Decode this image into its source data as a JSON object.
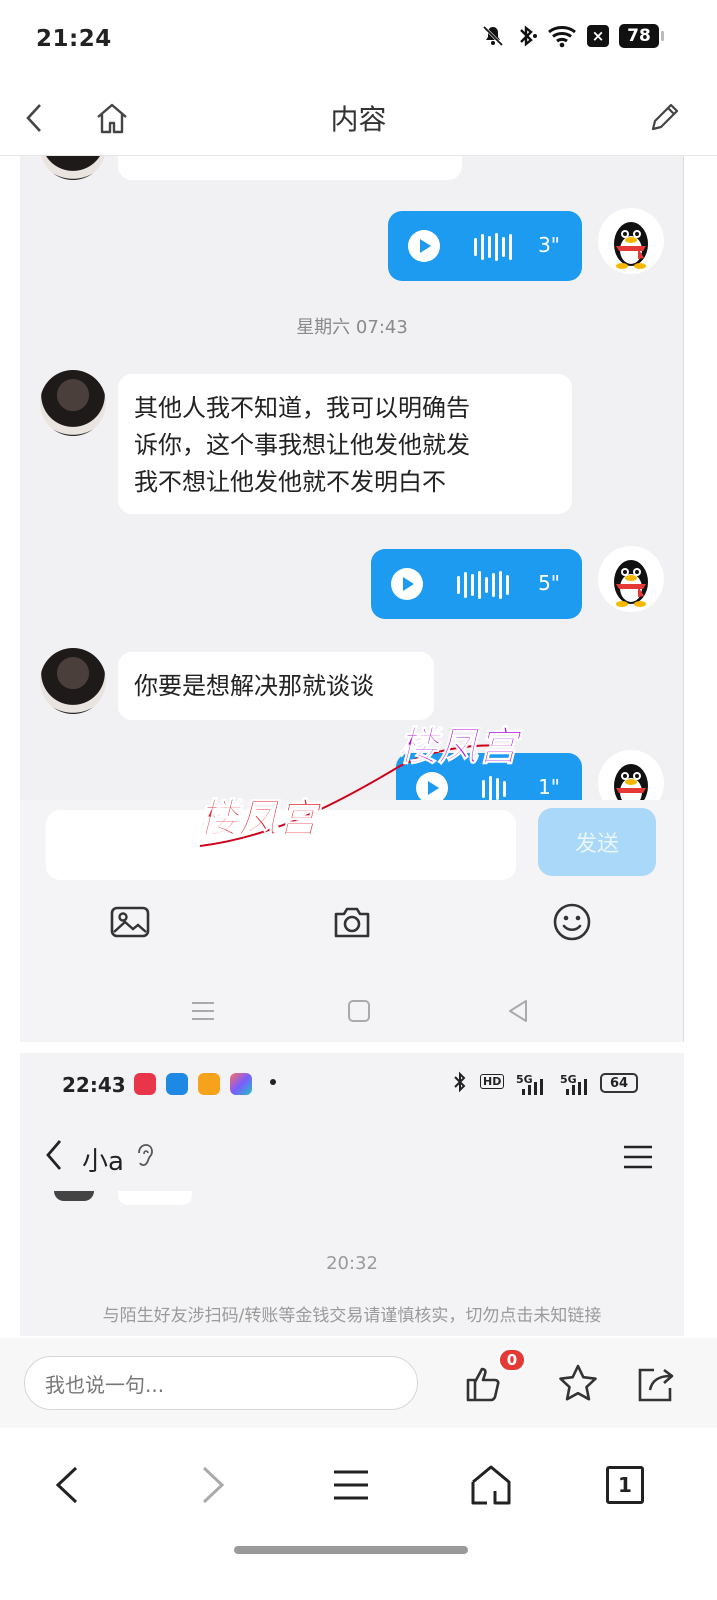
{
  "status_bar": {
    "time": "21:24",
    "battery": "78",
    "icons": [
      "mute-bell-icon",
      "bluetooth-icon",
      "wifi-icon",
      "x-app-icon",
      "battery-icon"
    ]
  },
  "top_nav": {
    "title": "内容",
    "back_icon": "chevron-left-icon",
    "home_icon": "home-icon",
    "edit_icon": "pencil-icon"
  },
  "chat_screenshot_1": {
    "messages": [
      {
        "side": "right",
        "type": "voice",
        "duration": "3\""
      },
      {
        "type": "timestamp",
        "text": "星期六 07:43"
      },
      {
        "side": "left",
        "type": "text",
        "lines": [
          "其他人我不知道，我可以明确告",
          "诉你，这个事我想让他发他就发",
          "我不想让他发他就不发明白不"
        ]
      },
      {
        "side": "right",
        "type": "voice",
        "duration": "5\""
      },
      {
        "side": "left",
        "type": "text",
        "lines": [
          "你要是想解决那就谈谈"
        ]
      },
      {
        "side": "right",
        "type": "voice",
        "duration": "1\""
      }
    ],
    "send_button": "发送",
    "tools": [
      "image-icon",
      "camera-icon",
      "emoji-icon"
    ],
    "watermark": "楼凤宫",
    "accent": "#1d9bf0"
  },
  "chat_screenshot_2": {
    "status_time": "22:43",
    "battery": "64",
    "network_labels": [
      "5G",
      "5G"
    ],
    "hd_label": "HD",
    "chat_title": "小a",
    "timestamp": "20:32",
    "warning": "与陌生好友涉扫码/转账等金钱交易请谨慎核实，切勿点击未知链接"
  },
  "comment_bar": {
    "placeholder": "我也说一句...",
    "like_count": "0",
    "icons": [
      "thumbs-up-icon",
      "star-icon",
      "share-icon"
    ]
  },
  "browser_bar": {
    "tab_count": "1",
    "icons": [
      "back-arrow-icon",
      "forward-arrow-icon",
      "menu-icon",
      "home-icon",
      "tabs-icon"
    ]
  }
}
